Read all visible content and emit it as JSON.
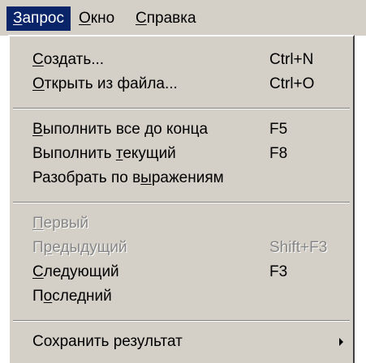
{
  "menubar": {
    "items": [
      {
        "pre": "",
        "u": "З",
        "post": "апрос"
      },
      {
        "pre": "",
        "u": "О",
        "post": "кно"
      },
      {
        "pre": "",
        "u": "С",
        "post": "правка"
      }
    ]
  },
  "menu": {
    "items": [
      {
        "pre": "",
        "u": "С",
        "post": "оздать...",
        "shortcut": "Ctrl+N"
      },
      {
        "pre": "",
        "u": "О",
        "post": "ткрыть из файла...",
        "shortcut": "Ctrl+O"
      },
      {
        "pre": "",
        "u": "В",
        "post": "ыполнить все до конца",
        "shortcut": "F5"
      },
      {
        "pre": "Выполнить ",
        "u": "т",
        "post": "екущий",
        "shortcut": "F8"
      },
      {
        "pre": "Разобрать по в",
        "u": "ы",
        "post": "ражениям",
        "shortcut": ""
      },
      {
        "pre": "",
        "u": "П",
        "post": "ервый",
        "shortcut": ""
      },
      {
        "pre": "П",
        "u": "р",
        "post": "едыдущий",
        "shortcut": "Shift+F3"
      },
      {
        "pre": "",
        "u": "С",
        "post": "ледующий",
        "shortcut": "F3"
      },
      {
        "pre": "П",
        "u": "о",
        "post": "следний",
        "shortcut": ""
      },
      {
        "pre": "Сохранить результат",
        "u": "",
        "post": "",
        "shortcut": ""
      }
    ]
  }
}
